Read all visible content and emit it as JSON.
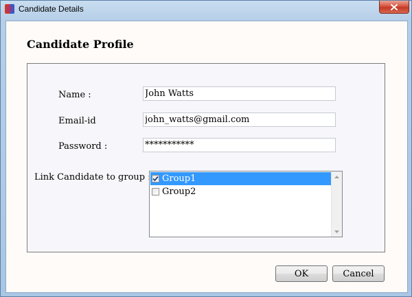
{
  "window": {
    "title": "Candidate Details"
  },
  "dialog": {
    "heading": "Candidate Profile",
    "fields": {
      "name": {
        "label": "Name :",
        "value": "John Watts"
      },
      "email": {
        "label": "Email-id",
        "value": "john_watts@gmail.com"
      },
      "password": {
        "label": "Password :",
        "value": "***********"
      }
    },
    "group_link": {
      "label": "Link Candidate to group :",
      "items": [
        {
          "label": "Group1",
          "checked": true,
          "selected": true
        },
        {
          "label": "Group2",
          "checked": false,
          "selected": false
        }
      ]
    },
    "buttons": {
      "ok": "OK",
      "cancel": "Cancel"
    }
  },
  "icons": {
    "app": "app-logo-icon",
    "close": "close-icon"
  },
  "colors": {
    "selection": "#3399ff",
    "close_button": "#c23a26"
  }
}
